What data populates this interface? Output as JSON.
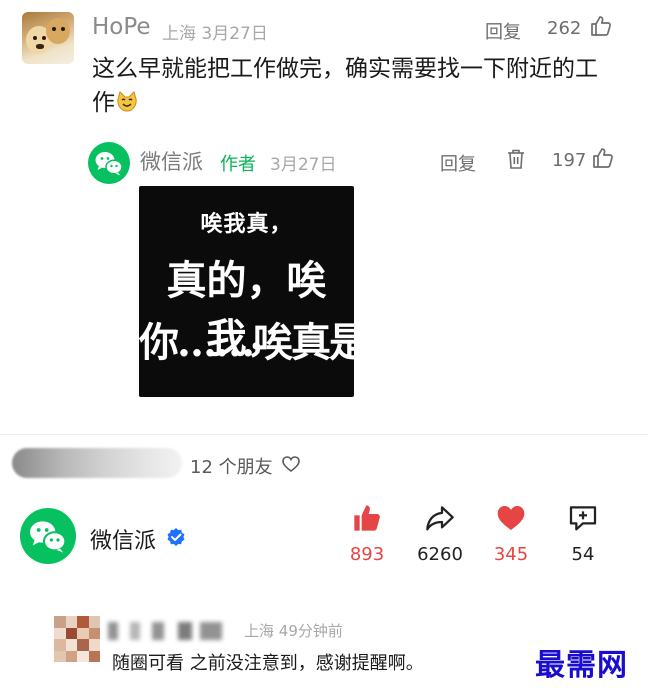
{
  "top_comment": {
    "author": "HoPe",
    "location": "上海",
    "date": "3月27日",
    "reply_label": "回复",
    "likes": "262",
    "text": "这么早就能把工作做完，确实需要找一下附近的工作"
  },
  "author_reply": {
    "author": "微信派",
    "author_tag": "作者",
    "date": "3月27日",
    "reply_label": "回复",
    "likes": "197",
    "meme_lines": [
      "唉我真，",
      "真的，唉我，",
      "你……唉真是"
    ]
  },
  "friends": {
    "label": "12 个朋友"
  },
  "account": {
    "name": "微信派",
    "actions": [
      {
        "icon": "thumbs-up-filled-icon",
        "count": "893",
        "color": "#e64545"
      },
      {
        "icon": "share-arrow-icon",
        "count": "6260",
        "color": "#222222"
      },
      {
        "icon": "heart-filled-icon",
        "count": "345",
        "color": "#e64545"
      },
      {
        "icon": "comment-plus-icon",
        "count": "54",
        "color": "#222222"
      }
    ]
  },
  "bottom_comment": {
    "location": "上海",
    "time": "49分钟前",
    "text": "随圈可看 之前没注意到，感谢提醒啊。"
  },
  "watermark": "最需网",
  "colors": {
    "wechat_green": "#07c160",
    "accent_red": "#e64545",
    "verified_blue": "#1f72ff"
  }
}
